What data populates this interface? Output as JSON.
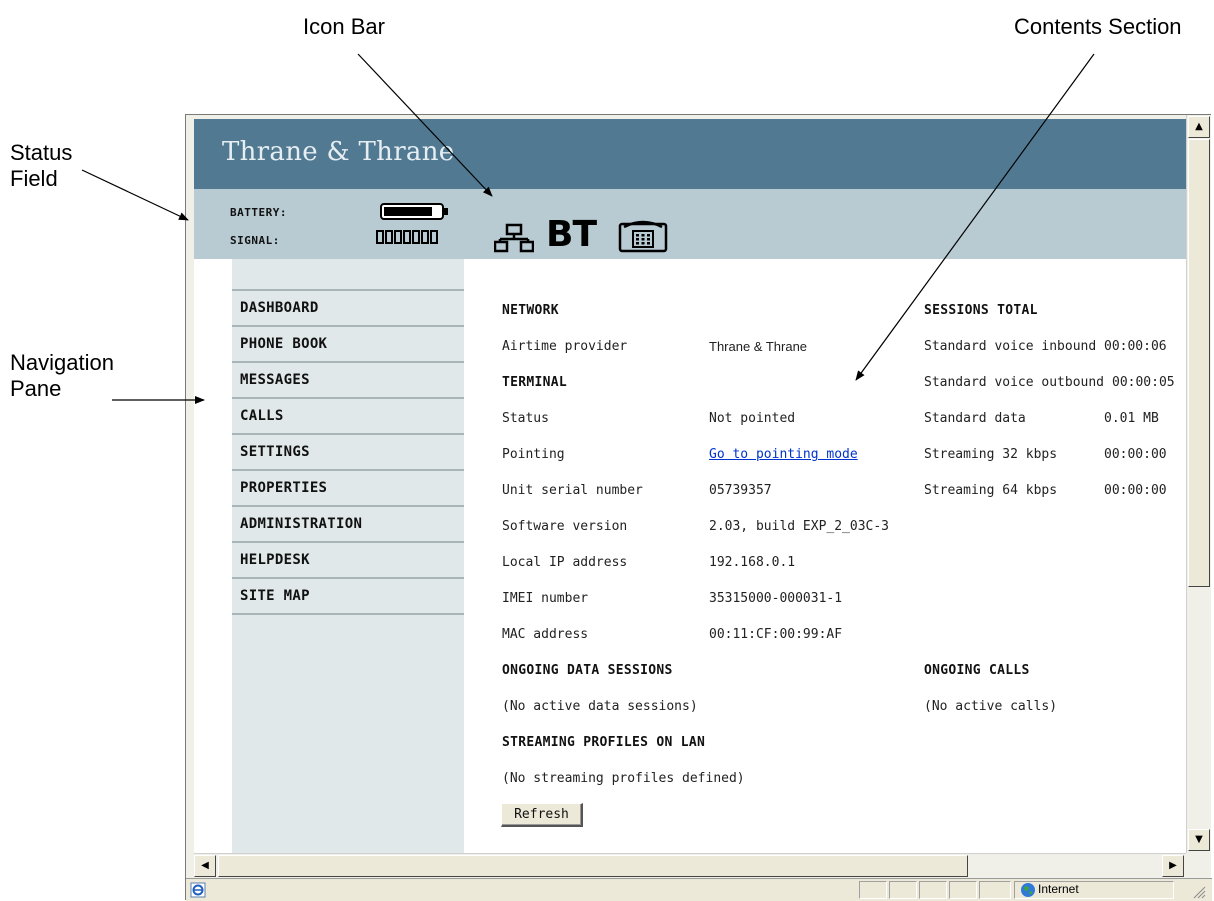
{
  "callouts": {
    "icon_bar": "Icon Bar",
    "contents_section": "Contents Section",
    "status_field_line1": "Status",
    "status_field_line2": "Field",
    "navigation_pane_line1": "Navigation",
    "navigation_pane_line2": "Pane"
  },
  "header": {
    "brand": "Thrane & Thrane"
  },
  "status": {
    "battery_label": "BATTERY:",
    "signal_label": "SIGNAL:",
    "battery_level": 0.85,
    "signal_bars_total": 7
  },
  "icons": [
    "lan-network-icon",
    "bt-icon",
    "phone-icon"
  ],
  "icon_text": {
    "bt": "BT"
  },
  "nav": {
    "items": [
      "DASHBOARD",
      "PHONE BOOK",
      "MESSAGES",
      "CALLS",
      "SETTINGS",
      "PROPERTIES",
      "ADMINISTRATION",
      "HELPDESK",
      "SITE MAP"
    ]
  },
  "content": {
    "network": {
      "title": "NETWORK",
      "airtime_label": "Airtime provider",
      "airtime_value": "Thrane & Thrane"
    },
    "terminal": {
      "title": "TERMINAL",
      "rows": [
        {
          "label": "Status",
          "value": "Not pointed"
        },
        {
          "label": "Pointing",
          "value": "Go to pointing mode"
        },
        {
          "label": "Unit serial number",
          "value": "05739357"
        },
        {
          "label": "Software version",
          "value": "2.03, build EXP_2_03C-3"
        },
        {
          "label": "Local IP address",
          "value": "192.168.0.1"
        },
        {
          "label": "IMEI number",
          "value": "35315000-000031-1"
        },
        {
          "label": "MAC address",
          "value": "00:11:CF:00:99:AF"
        }
      ]
    },
    "sessions_total": {
      "title": "SESSIONS TOTAL",
      "rows": [
        {
          "label": "Standard voice inbound",
          "value": "00:00:06"
        },
        {
          "label": "Standard voice outbound",
          "value": "00:00:05"
        },
        {
          "label": "Standard data",
          "value": "0.01 MB"
        },
        {
          "label": "Streaming 32 kbps",
          "value": "00:00:00"
        },
        {
          "label": "Streaming 64 kbps",
          "value": "00:00:00"
        }
      ]
    },
    "ongoing_data": {
      "title": "ONGOING DATA SESSIONS",
      "text": "(No active data sessions)"
    },
    "ongoing_calls": {
      "title": "ONGOING CALLS",
      "text": "(No active calls)"
    },
    "streaming_profiles": {
      "title": "STREAMING PROFILES ON LAN",
      "text": "(No streaming profiles defined)"
    },
    "refresh_label": "Refresh"
  },
  "browser_status": {
    "zone": "Internet"
  }
}
